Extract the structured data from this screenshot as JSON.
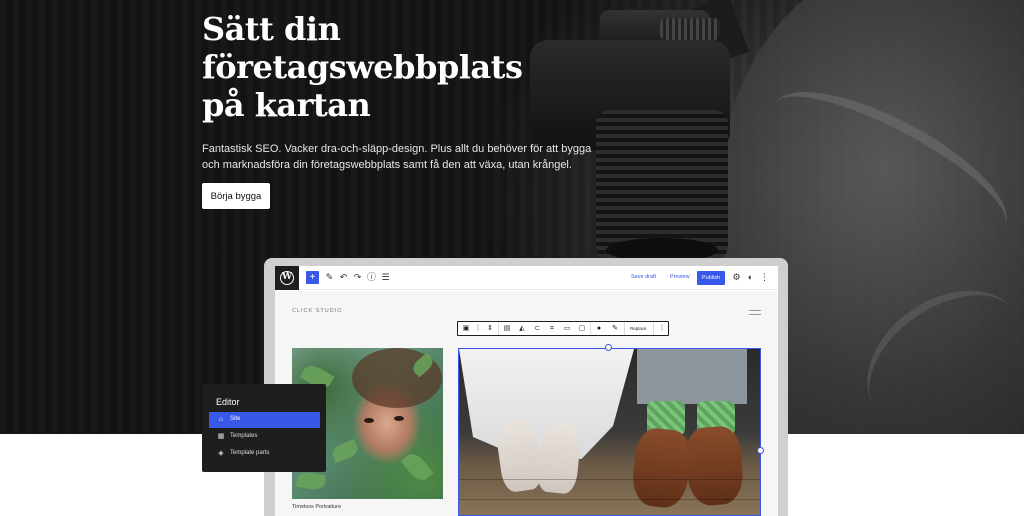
{
  "hero": {
    "title_lines": [
      "Sätt din",
      "företagswebbplats",
      "på kartan"
    ],
    "subtitle": "Fantastisk SEO. Vacker dra-och-släpp-design. Plus allt du behöver för att bygga och marknadsföra din företagswebbplats samt få den att växa, utan krångel.",
    "cta_label": "Börja bygga"
  },
  "editor_mockup": {
    "topbar": {
      "logo": "W",
      "add_icon": "+",
      "save_draft": "Save draft",
      "preview": "Preview",
      "publish": "Publish"
    },
    "site_name": "CLICK STUDIO",
    "block_toolbar": {
      "replace": "Replace"
    },
    "caption": "Timeless Portraiture"
  },
  "editor_panel": {
    "title": "Editor",
    "items": [
      {
        "label": "Site",
        "icon": "home-icon",
        "active": true
      },
      {
        "label": "Templates",
        "icon": "layout-icon",
        "active": false
      },
      {
        "label": "Template parts",
        "icon": "symbol-icon",
        "active": false
      }
    ]
  },
  "colors": {
    "accent": "#3858e9",
    "panel": "#1e1e1e",
    "hero_text": "#ffffff"
  }
}
